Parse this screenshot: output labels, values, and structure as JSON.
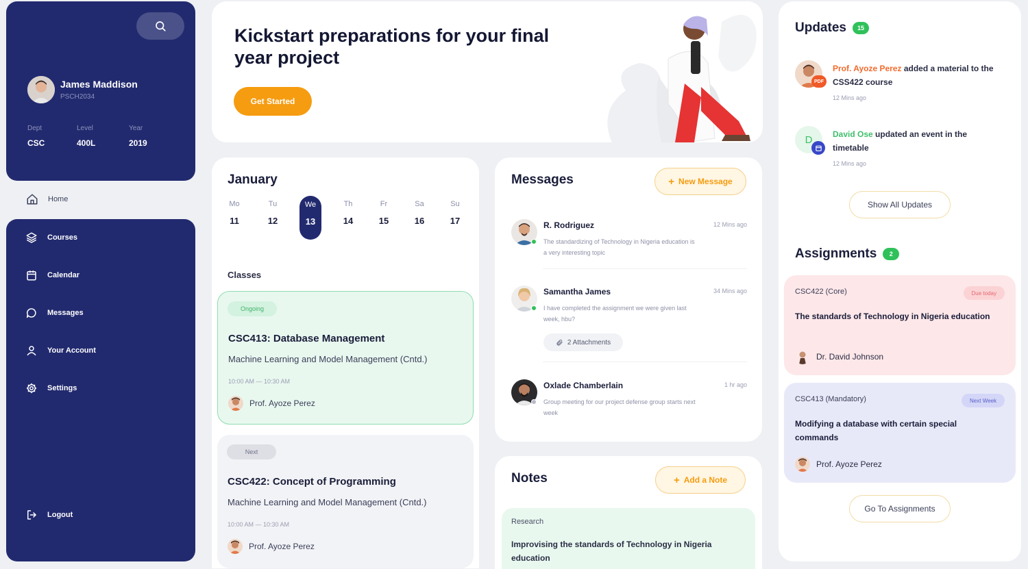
{
  "profile": {
    "name": "James Maddison",
    "id": "PSCH2034",
    "stats": [
      {
        "label": "Dept",
        "value": "CSC"
      },
      {
        "label": "Level",
        "value": "400L"
      },
      {
        "label": "Year",
        "value": "2019"
      }
    ]
  },
  "sidebar": {
    "home_label": "Home",
    "items": [
      {
        "label": "Courses",
        "icon": "layers-icon"
      },
      {
        "label": "Calendar",
        "icon": "calendar-icon"
      },
      {
        "label": "Messages",
        "icon": "chat-bubble-icon"
      },
      {
        "label": "Your Account",
        "icon": "user-icon"
      },
      {
        "label": "Settings",
        "icon": "gear-icon"
      }
    ],
    "logout_label": "Logout"
  },
  "hero": {
    "title": "Kickstart preparations for your final year project",
    "button_label": "Get Started"
  },
  "calendar": {
    "month": "January",
    "days": [
      {
        "name": "Mo",
        "num": "11"
      },
      {
        "name": "Tu",
        "num": "12"
      },
      {
        "name": "We",
        "num": "13"
      },
      {
        "name": "Th",
        "num": "14"
      },
      {
        "name": "Fr",
        "num": "15"
      },
      {
        "name": "Sa",
        "num": "16"
      },
      {
        "name": "Su",
        "num": "17"
      }
    ],
    "classes_label": "Classes",
    "classes": [
      {
        "status": "Ongoing",
        "title": "CSC413: Database Management",
        "subtitle": "Machine Learning and Model Management (Cntd.)",
        "time": "10:00 AM — 10:30 AM",
        "teacher": "Prof. Ayoze Perez"
      },
      {
        "status": "Next",
        "title": "CSC422: Concept of Programming",
        "subtitle": "Machine Learning and Model Management (Cntd.)",
        "time": "10:00 AM — 10:30 AM",
        "teacher": "Prof. Ayoze Perez"
      }
    ]
  },
  "messages": {
    "title": "Messages",
    "new_button": "New Message",
    "items": [
      {
        "name": "R. Rodriguez",
        "time": "12 Mins ago",
        "text": "The standardizing of Technology in Nigeria education is a very interesting topic"
      },
      {
        "name": "Samantha James",
        "time": "34 Mins ago",
        "text": "I have completed the assignment we were given last week, hbu?",
        "attachments": "2 Attachments"
      },
      {
        "name": "Oxlade Chamberlain",
        "time": "1 hr ago",
        "text": "Group meeting for our project defense group starts next week"
      }
    ]
  },
  "notes": {
    "title": "Notes",
    "add_button": "Add a Note",
    "item": {
      "tag": "Research",
      "text": "Improvising the standards of Technology in Nigeria education"
    }
  },
  "updates": {
    "title": "Updates",
    "count": "15",
    "items": [
      {
        "actor": "Prof. Ayoze Perez",
        "action": " added a material to the CSS422 course",
        "time": "12 Mins ago",
        "actor_color": "#f26b2d"
      },
      {
        "actor": "David Ose",
        "action": " updated an event in the timetable",
        "time": "12 Mins ago",
        "actor_color": "#3fbf6a"
      }
    ],
    "show_all": "Show All Updates"
  },
  "assignments": {
    "title": "Assignments",
    "count": "2",
    "items": [
      {
        "code": "CSC422 (Core)",
        "due": "Due today",
        "title": "The standards of Technology in Nigeria education",
        "teacher": "Dr. David Johnson"
      },
      {
        "code": "CSC413 (Mandatory)",
        "due": "Next Week",
        "title": "Modifying a database with certain special commands",
        "teacher": "Prof. Ayoze Perez"
      }
    ],
    "go_button": "Go To Assignments"
  }
}
